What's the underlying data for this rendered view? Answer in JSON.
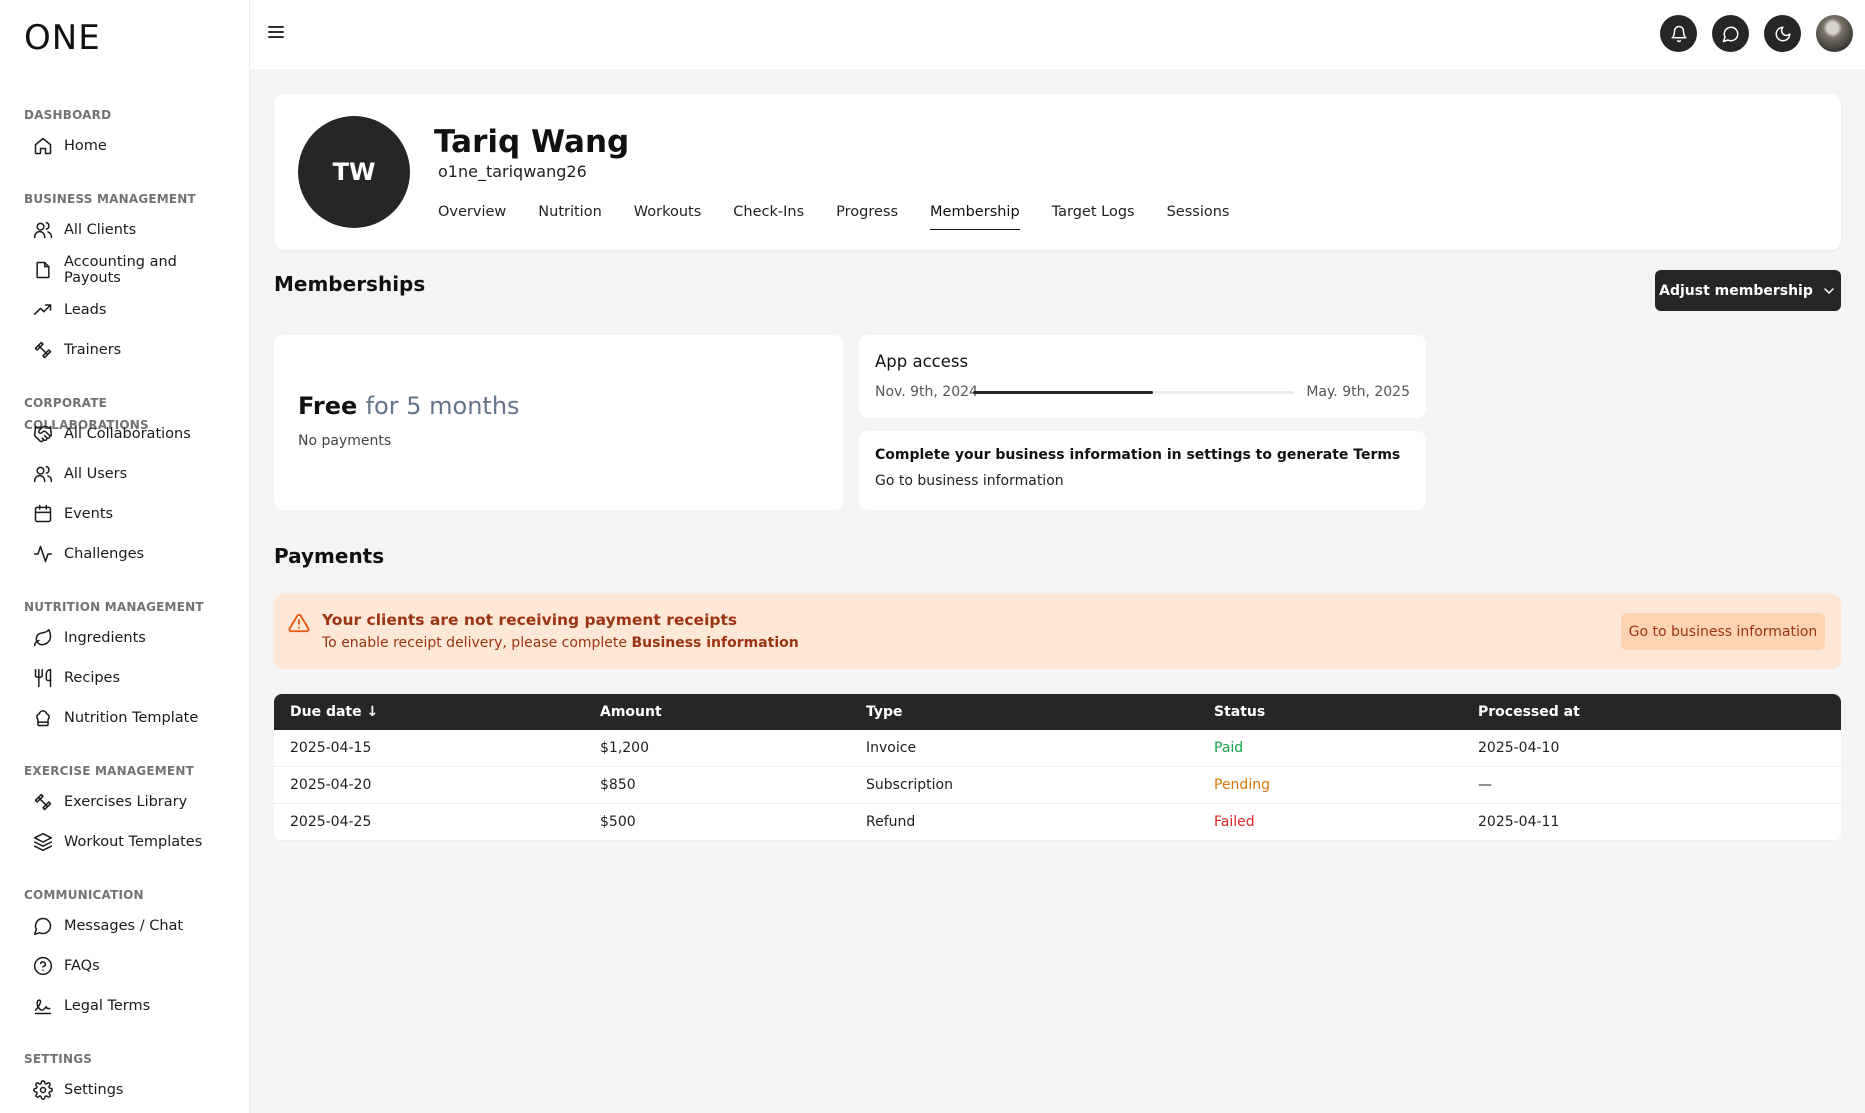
{
  "app": {
    "logo": "ONE"
  },
  "sidebar": {
    "sections": [
      {
        "title": "DASHBOARD",
        "items": [
          {
            "label": "Home",
            "icon": "home-icon"
          }
        ]
      },
      {
        "title": "BUSINESS MANAGEMENT",
        "items": [
          {
            "label": "All Clients",
            "icon": "users-icon"
          },
          {
            "label": "Accounting and Payouts",
            "icon": "file-icon"
          },
          {
            "label": "Leads",
            "icon": "trending-up-icon"
          },
          {
            "label": "Trainers",
            "icon": "dumbbell-icon"
          }
        ]
      },
      {
        "title": "CORPORATE COLLABORATIONS",
        "items": [
          {
            "label": "All Collaborations",
            "icon": "handshake-icon"
          },
          {
            "label": "All Users",
            "icon": "users-icon"
          },
          {
            "label": "Events",
            "icon": "calendar-icon"
          },
          {
            "label": "Challenges",
            "icon": "activity-icon"
          }
        ]
      },
      {
        "title": "NUTRITION MANAGEMENT",
        "items": [
          {
            "label": "Ingredients",
            "icon": "leaf-icon"
          },
          {
            "label": "Recipes",
            "icon": "utensils-icon"
          },
          {
            "label": "Nutrition Template",
            "icon": "chef-hat-icon"
          }
        ]
      },
      {
        "title": "EXERCISE MANAGEMENT",
        "items": [
          {
            "label": "Exercises Library",
            "icon": "dumbbell-icon"
          },
          {
            "label": "Workout Templates",
            "icon": "layers-icon"
          }
        ]
      },
      {
        "title": "COMMUNICATION",
        "items": [
          {
            "label": "Messages / Chat",
            "icon": "message-icon"
          },
          {
            "label": "FAQs",
            "icon": "help-icon"
          },
          {
            "label": "Legal Terms",
            "icon": "signature-icon"
          }
        ]
      },
      {
        "title": "SETTINGS",
        "items": [
          {
            "label": "Settings",
            "icon": "gear-icon"
          }
        ]
      }
    ]
  },
  "header": {
    "icons": [
      "bell-icon",
      "chat-icon",
      "moon-icon",
      "user-avatar"
    ]
  },
  "profile": {
    "initials": "TW",
    "name": "Tariq Wang",
    "username": "o1ne_tariqwang26",
    "tabs": [
      "Overview",
      "Nutrition",
      "Workouts",
      "Check-Ins",
      "Progress",
      "Membership",
      "Target Logs",
      "Sessions"
    ],
    "active_tab": "Membership"
  },
  "memberships": {
    "title": "Memberships",
    "adjust_button": "Adjust membership",
    "plan": {
      "name": "Free",
      "duration": "for 5 months",
      "payments": "No payments"
    },
    "app_access": {
      "title": "App access",
      "start": "Nov. 9th, 2024",
      "end": "May. 9th, 2025",
      "progress": 0.56
    },
    "terms": {
      "title": "Complete your business information in settings to generate Terms",
      "link": "Go to business information"
    }
  },
  "payments": {
    "title": "Payments",
    "alert": {
      "title": "Your clients are not receiving payment receipts",
      "text_prefix": "To enable receipt delivery, please complete",
      "text_link": "Business information",
      "button": "Go to business information"
    },
    "columns": [
      "Due date ↓",
      "Amount",
      "Type",
      "Status",
      "Processed at"
    ],
    "rows": [
      {
        "due": "2025-04-15",
        "amount": "$1,200",
        "type": "Invoice",
        "status": "Paid",
        "processed": "2025-04-10"
      },
      {
        "due": "2025-04-20",
        "amount": "$850",
        "type": "Subscription",
        "status": "Pending",
        "processed": "—"
      },
      {
        "due": "2025-04-25",
        "amount": "$500",
        "type": "Refund",
        "status": "Failed",
        "processed": "2025-04-11"
      }
    ],
    "status_colors": {
      "Paid": "#16a34a",
      "Pending": "#d97706",
      "Failed": "#dc2626"
    }
  },
  "colors": {
    "accent_dark": "#262626",
    "alert_bg": "#fde8d7",
    "alert_text": "#9a3412"
  }
}
